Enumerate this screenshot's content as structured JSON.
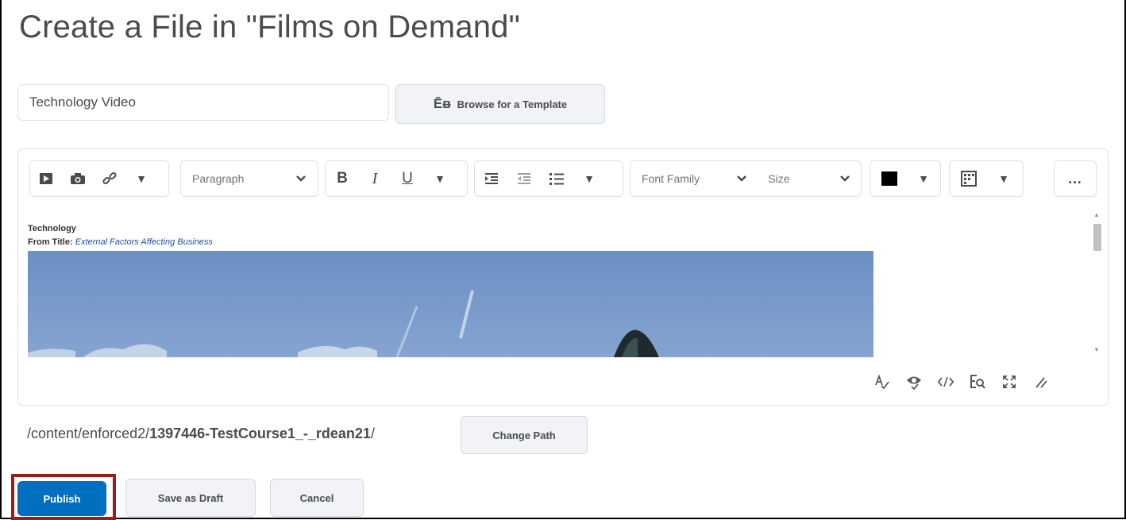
{
  "page": {
    "title": "Create a File in \"Films on Demand\""
  },
  "form": {
    "title_value": "Technology Video",
    "browse_template_label": "Browse for a Template"
  },
  "toolbar": {
    "block_format": "Paragraph",
    "font_family": "Font Family",
    "font_size": "Size",
    "bold": "B",
    "italic": "I",
    "underline": "U",
    "more": "…"
  },
  "content": {
    "video_title": "Technology",
    "from_label": "From Title:",
    "from_value": "External Factors Affecting Business"
  },
  "path": {
    "prefix": "/content/enforced2/",
    "course": "1397446-TestCourse1_-_rdean21",
    "suffix": "/",
    "change_label": "Change Path"
  },
  "actions": {
    "publish": "Publish",
    "save_draft": "Save as Draft",
    "cancel": "Cancel"
  },
  "colors": {
    "primary": "#006fbf",
    "highlight": "#9b1b1f",
    "text_color_swatch": "#000000"
  },
  "icons": [
    "insert-video-icon",
    "insert-image-icon",
    "insert-link-icon",
    "indent-icon",
    "outdent-icon",
    "bullet-list-icon",
    "table-icon",
    "spellcheck-icon",
    "preview-icon",
    "source-code-icon",
    "find-replace-icon",
    "fullscreen-icon",
    "resize-icon",
    "template-icon"
  ]
}
